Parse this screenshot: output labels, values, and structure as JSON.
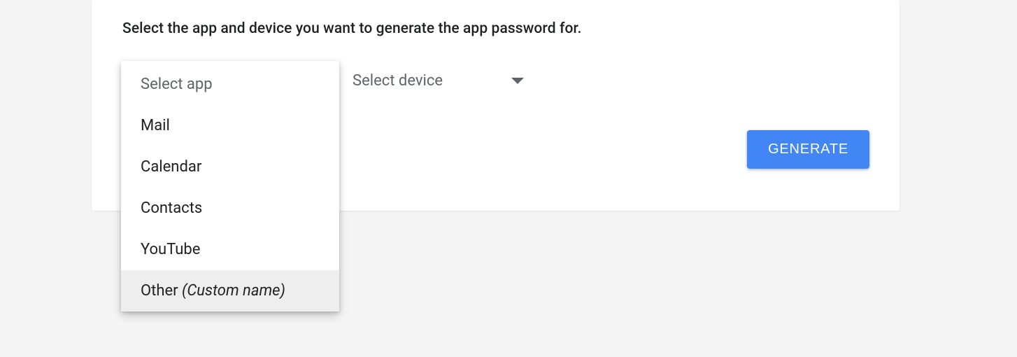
{
  "instruction": "Select the app and device you want to generate the app password for.",
  "app_select": {
    "placeholder": "Select app",
    "options": [
      {
        "label": "Mail"
      },
      {
        "label": "Calendar"
      },
      {
        "label": "Contacts"
      },
      {
        "label": "YouTube"
      },
      {
        "label": "Other ",
        "suffix": "(Custom name)",
        "hovered": true
      }
    ]
  },
  "device_select": {
    "placeholder": "Select device"
  },
  "generate_button": "GENERATE"
}
